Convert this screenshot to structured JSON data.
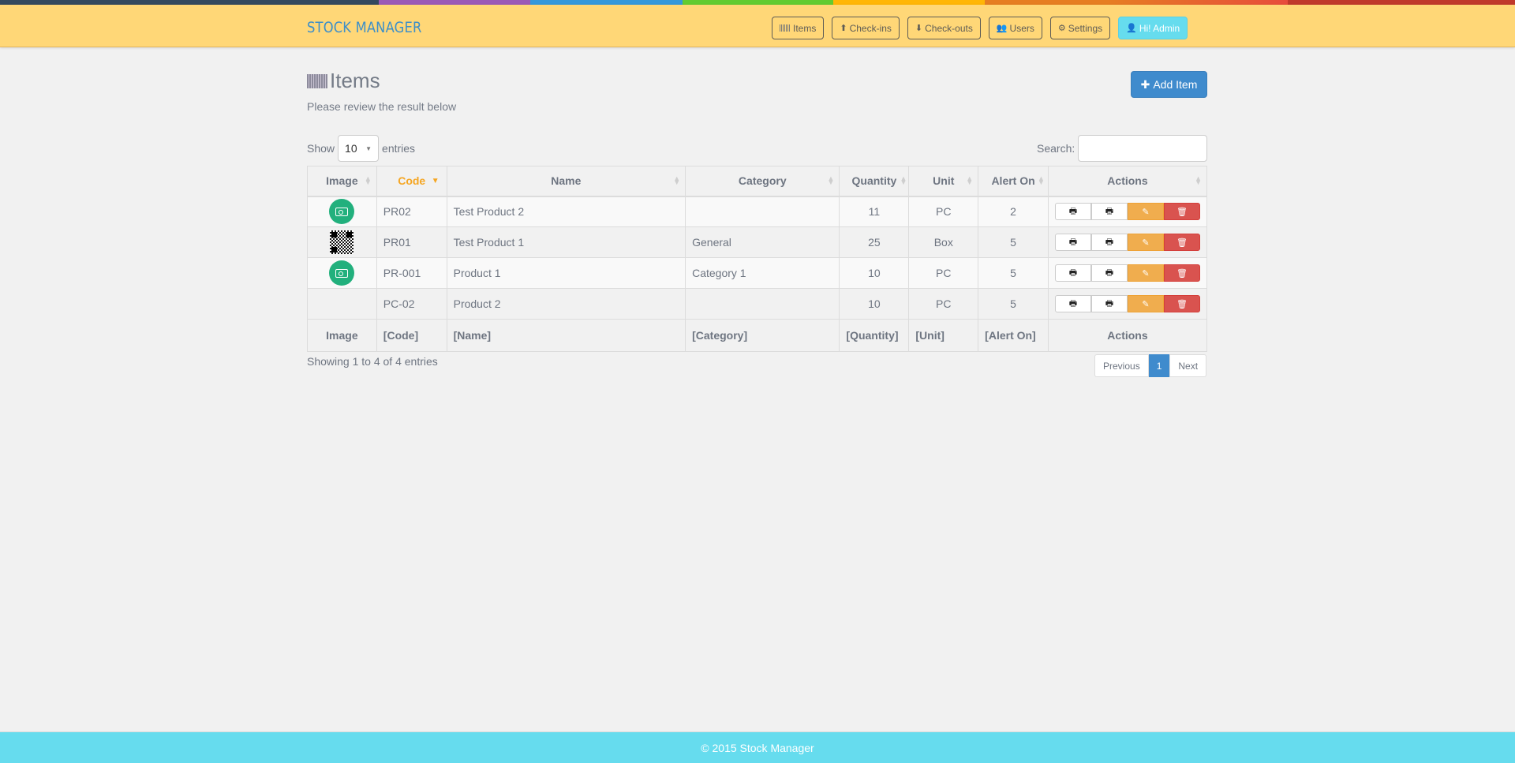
{
  "theme": {
    "rainbow": [
      "#34495e",
      "#9b59b6",
      "#3498db",
      "#62cb31",
      "#ffb606",
      "#e67e22",
      "#e74c3c",
      "#c0392b"
    ],
    "navbar_bg": "#ffd777",
    "accent_blue": "#3f8bcd",
    "footer_bg": "#66dcee"
  },
  "navbar": {
    "brand": "STOCK MANAGER",
    "buttons": [
      {
        "label": "Items",
        "icon": "barcode-icon"
      },
      {
        "label": "Check-ins",
        "icon": "arrow-circle-up-icon"
      },
      {
        "label": "Check-outs",
        "icon": "arrow-circle-down-icon"
      },
      {
        "label": "Users",
        "icon": "users-icon"
      },
      {
        "label": "Settings",
        "icon": "gears-icon"
      },
      {
        "label": "Hi! Admin",
        "icon": "user-icon"
      }
    ]
  },
  "page": {
    "title": "Items",
    "subtitle": "Please review the result below",
    "add_button": "Add Item"
  },
  "table_controls": {
    "show_label": "Show",
    "entries_label": "entries",
    "page_length": "10",
    "search_label": "Search:",
    "search_value": ""
  },
  "table": {
    "columns": [
      "Image",
      "Code",
      "Name",
      "Category",
      "Quantity",
      "Unit",
      "Alert On",
      "Actions"
    ],
    "sorted_column": "Code",
    "rows": [
      {
        "image": "camera-icon",
        "code": "PR02",
        "name": "Test Product 2",
        "category": "",
        "quantity": "11",
        "unit": "PC",
        "alert_on": "2"
      },
      {
        "image": "qr-code",
        "code": "PR01",
        "name": "Test Product 1",
        "category": "General",
        "quantity": "25",
        "unit": "Box",
        "alert_on": "5"
      },
      {
        "image": "camera-icon",
        "code": "PR-001",
        "name": "Product 1",
        "category": "Category 1",
        "quantity": "10",
        "unit": "PC",
        "alert_on": "5"
      },
      {
        "image": "",
        "code": "PC-02",
        "name": "Product 2",
        "category": "",
        "quantity": "10",
        "unit": "PC",
        "alert_on": "5"
      }
    ],
    "footer": [
      "Image",
      "[Code]",
      "[Name]",
      "[Category]",
      "[Quantity]",
      "[Unit]",
      "[Alert On]",
      "Actions"
    ],
    "action_icons": [
      "print-icon",
      "print-icon",
      "edit-icon",
      "trash-icon"
    ]
  },
  "pagination": {
    "info": "Showing 1 to 4 of 4 entries",
    "previous": "Previous",
    "current": "1",
    "next": "Next"
  },
  "footer": {
    "text": "© 2015 Stock Manager"
  }
}
